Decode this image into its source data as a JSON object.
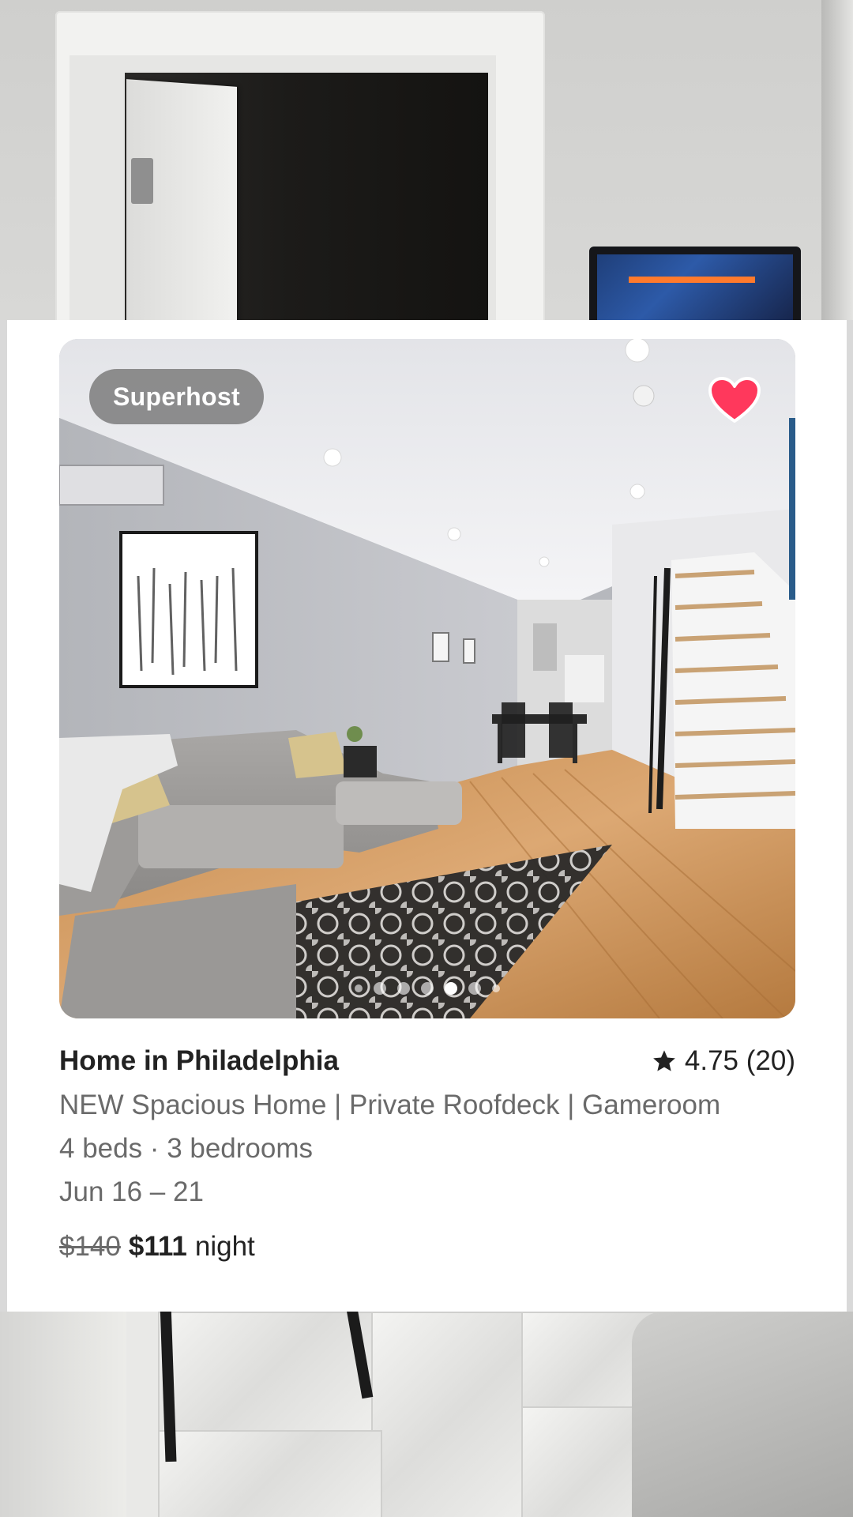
{
  "listing": {
    "badge": "Superhost",
    "title": "Home in Philadelphia",
    "rating": "4.75 (20)",
    "description": "NEW Spacious Home | Private Roofdeck | Gameroom",
    "beds": "4 beds · 3 bedrooms",
    "dates": "Jun 16 – 21",
    "original_price": "$140",
    "price": "$111",
    "price_unit": "night",
    "favorited": true,
    "photo_count": 7,
    "active_photo_index": 4
  },
  "colors": {
    "heart": "#ff385c",
    "text_primary": "#222222",
    "text_secondary": "#6a6a6a"
  },
  "icons": {
    "favorite": "heart-icon",
    "rating": "star-icon"
  }
}
